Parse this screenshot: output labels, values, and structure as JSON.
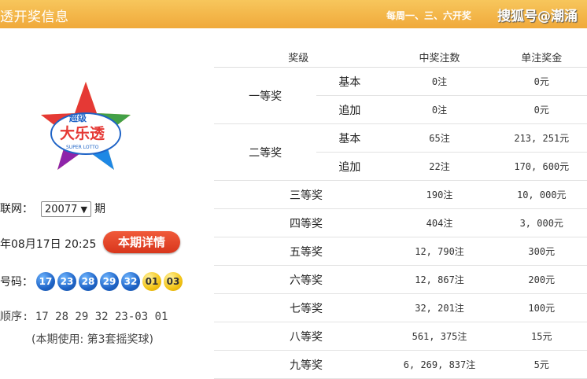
{
  "header": {
    "title": "透开奖信息",
    "schedule": "每周一、三、六开奖",
    "watermark": "搜狐号@潮涌"
  },
  "logo": {
    "top_text": "超级",
    "main_text": "大乐透",
    "sub_text": "SUPER LOTTO",
    "colors": [
      "#e53935",
      "#fbc02d",
      "#43a047",
      "#1e88e5",
      "#8e24aa"
    ]
  },
  "draw": {
    "issue_label": "联网：",
    "issue_value": "20077",
    "issue_suffix": "期",
    "date_text": "年08月17日 20:25",
    "detail_button": "本期详情",
    "numbers_label": "号码：",
    "front_numbers": [
      "17",
      "23",
      "28",
      "29",
      "32"
    ],
    "back_numbers": [
      "01",
      "03"
    ],
    "order_text": "顺序: 17 28 29 32 23-03 01",
    "note_text": "(本期使用: 第3套摇奖球)"
  },
  "table": {
    "headers": [
      "奖级",
      "中奖注数",
      "单注奖金"
    ],
    "rows": [
      {
        "level": "一等奖",
        "sub": "基本",
        "count": "0注",
        "amount": "0元"
      },
      {
        "level": "",
        "sub": "追加",
        "count": "0注",
        "amount": "0元"
      },
      {
        "level": "二等奖",
        "sub": "基本",
        "count": "65注",
        "amount": "213, 251元"
      },
      {
        "level": "",
        "sub": "追加",
        "count": "22注",
        "amount": "170, 600元"
      },
      {
        "level": "三等奖",
        "sub": "",
        "count": "190注",
        "amount": "10, 000元"
      },
      {
        "level": "四等奖",
        "sub": "",
        "count": "404注",
        "amount": "3, 000元"
      },
      {
        "level": "五等奖",
        "sub": "",
        "count": "12, 790注",
        "amount": "300元"
      },
      {
        "level": "六等奖",
        "sub": "",
        "count": "12, 867注",
        "amount": "200元"
      },
      {
        "level": "七等奖",
        "sub": "",
        "count": "32, 201注",
        "amount": "100元"
      },
      {
        "level": "八等奖",
        "sub": "",
        "count": "561, 375注",
        "amount": "15元"
      },
      {
        "level": "九等奖",
        "sub": "",
        "count": "6, 269, 837注",
        "amount": "5元"
      }
    ]
  }
}
